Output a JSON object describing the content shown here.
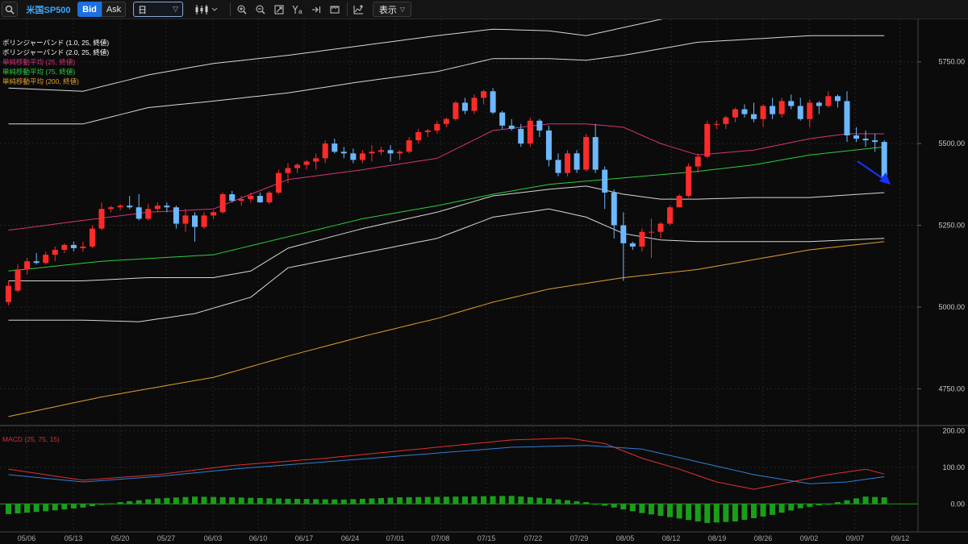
{
  "toolbar": {
    "symbol": "米国SP500",
    "bid_label": "Bid",
    "ask_label": "Ask",
    "period_value": "日",
    "display_label": "表示",
    "icons": [
      "search-icon",
      "candlestick-icon",
      "zoom-in-icon",
      "zoom-out-icon",
      "fit-icon",
      "text-tool-icon",
      "jump-to-end-icon",
      "ruler-icon",
      "indicator-icon"
    ]
  },
  "legend": [
    {
      "text": "ボリンジャーバンド (1.0, 25, 終値)",
      "color": "#ffffff"
    },
    {
      "text": "ボリンジャーバンド (2.0, 25, 終値)",
      "color": "#ffffff"
    },
    {
      "text": "単純移動平均 (25, 終値)",
      "color": "#d6337a"
    },
    {
      "text": "単純移動平均 (75, 終値)",
      "color": "#2ecc40"
    },
    {
      "text": "単純移動平均 (200, 終値)",
      "color": "#e0a030"
    }
  ],
  "macd_legend": "MACD (25, 75, 15)",
  "chart_data": [
    {
      "type": "candlestick",
      "x_labels": [
        "05/06",
        "05/13",
        "05/20",
        "05/27",
        "06/03",
        "06/10",
        "06/17",
        "06/24",
        "07/01",
        "07/08",
        "07/15",
        "07/22",
        "07/29",
        "08/05",
        "08/12",
        "08/19",
        "08/26",
        "09/02",
        "09/07",
        "09/12"
      ],
      "y_ticks": [
        4750,
        5000,
        5250,
        5500,
        5750
      ],
      "y_tick_labels": [
        "4750.00",
        "5000.00",
        "5250.00",
        "5500.00",
        "5750.00"
      ],
      "ylim": [
        4640,
        5880
      ],
      "ohlc": [
        [
          5015,
          5080,
          5005,
          5065
        ],
        [
          5050,
          5130,
          5045,
          5115
        ],
        [
          5115,
          5150,
          5100,
          5140
        ],
        [
          5140,
          5165,
          5130,
          5135
        ],
        [
          5135,
          5170,
          5130,
          5160
        ],
        [
          5160,
          5185,
          5140,
          5175
        ],
        [
          5175,
          5195,
          5165,
          5190
        ],
        [
          5190,
          5200,
          5170,
          5180
        ],
        [
          5180,
          5200,
          5170,
          5185
        ],
        [
          5185,
          5250,
          5180,
          5240
        ],
        [
          5240,
          5320,
          5235,
          5300
        ],
        [
          5300,
          5310,
          5290,
          5305
        ],
        [
          5305,
          5315,
          5295,
          5310
        ],
        [
          5310,
          5340,
          5300,
          5305
        ],
        [
          5305,
          5345,
          5265,
          5270
        ],
        [
          5270,
          5315,
          5265,
          5300
        ],
        [
          5300,
          5320,
          5290,
          5310
        ],
        [
          5310,
          5320,
          5290,
          5305
        ],
        [
          5305,
          5310,
          5240,
          5255
        ],
        [
          5255,
          5300,
          5230,
          5280
        ],
        [
          5280,
          5290,
          5200,
          5245
        ],
        [
          5245,
          5290,
          5240,
          5280
        ],
        [
          5280,
          5295,
          5270,
          5290
        ],
        [
          5290,
          5350,
          5285,
          5345
        ],
        [
          5345,
          5355,
          5320,
          5325
        ],
        [
          5325,
          5340,
          5310,
          5330
        ],
        [
          5330,
          5350,
          5320,
          5340
        ],
        [
          5340,
          5350,
          5320,
          5320
        ],
        [
          5320,
          5355,
          5315,
          5350
        ],
        [
          5350,
          5420,
          5345,
          5410
        ],
        [
          5410,
          5440,
          5380,
          5425
        ],
        [
          5425,
          5440,
          5410,
          5435
        ],
        [
          5435,
          5450,
          5420,
          5445
        ],
        [
          5445,
          5470,
          5420,
          5455
        ],
        [
          5455,
          5510,
          5440,
          5500
        ],
        [
          5500,
          5515,
          5470,
          5475
        ],
        [
          5475,
          5490,
          5455,
          5470
        ],
        [
          5470,
          5485,
          5440,
          5450
        ],
        [
          5450,
          5480,
          5440,
          5470
        ],
        [
          5470,
          5495,
          5445,
          5475
        ],
        [
          5475,
          5490,
          5465,
          5480
        ],
        [
          5480,
          5495,
          5445,
          5470
        ],
        [
          5470,
          5480,
          5450,
          5475
        ],
        [
          5475,
          5520,
          5470,
          5510
        ],
        [
          5510,
          5545,
          5500,
          5535
        ],
        [
          5535,
          5545,
          5520,
          5540
        ],
        [
          5540,
          5570,
          5530,
          5560
        ],
        [
          5560,
          5580,
          5550,
          5575
        ],
        [
          5575,
          5630,
          5570,
          5625
        ],
        [
          5625,
          5640,
          5590,
          5600
        ],
        [
          5600,
          5650,
          5590,
          5640
        ],
        [
          5640,
          5665,
          5620,
          5660
        ],
        [
          5660,
          5670,
          5590,
          5595
        ],
        [
          5595,
          5600,
          5545,
          5555
        ],
        [
          5555,
          5575,
          5540,
          5545
        ],
        [
          5545,
          5560,
          5490,
          5500
        ],
        [
          5500,
          5580,
          5490,
          5570
        ],
        [
          5570,
          5575,
          5520,
          5540
        ],
        [
          5540,
          5555,
          5430,
          5450
        ],
        [
          5450,
          5470,
          5400,
          5410
        ],
        [
          5410,
          5480,
          5400,
          5470
        ],
        [
          5470,
          5480,
          5410,
          5420
        ],
        [
          5420,
          5530,
          5415,
          5520
        ],
        [
          5520,
          5560,
          5410,
          5420
        ],
        [
          5420,
          5430,
          5300,
          5350
        ],
        [
          5350,
          5360,
          5210,
          5250
        ],
        [
          5250,
          5290,
          5080,
          5195
        ],
        [
          5195,
          5200,
          5175,
          5185
        ],
        [
          5185,
          5240,
          5170,
          5230
        ],
        [
          5230,
          5270,
          5150,
          5230
        ],
        [
          5230,
          5260,
          5210,
          5255
        ],
        [
          5255,
          5310,
          5250,
          5305
        ],
        [
          5305,
          5345,
          5305,
          5340
        ],
        [
          5340,
          5440,
          5335,
          5430
        ],
        [
          5430,
          5470,
          5410,
          5460
        ],
        [
          5460,
          5570,
          5455,
          5560
        ],
        [
          5560,
          5570,
          5545,
          5560
        ],
        [
          5560,
          5585,
          5545,
          5580
        ],
        [
          5580,
          5610,
          5565,
          5605
        ],
        [
          5605,
          5620,
          5580,
          5590
        ],
        [
          5590,
          5625,
          5565,
          5575
        ],
        [
          5575,
          5620,
          5550,
          5615
        ],
        [
          5615,
          5640,
          5575,
          5590
        ],
        [
          5590,
          5640,
          5580,
          5630
        ],
        [
          5630,
          5650,
          5605,
          5615
        ],
        [
          5615,
          5640,
          5570,
          5575
        ],
        [
          5575,
          5635,
          5550,
          5625
        ],
        [
          5625,
          5630,
          5590,
          5615
        ],
        [
          5615,
          5660,
          5610,
          5645
        ],
        [
          5645,
          5650,
          5610,
          5630
        ],
        [
          5630,
          5660,
          5505,
          5525
        ],
        [
          5525,
          5550,
          5505,
          5515
        ],
        [
          5515,
          5540,
          5490,
          5510
        ],
        [
          5510,
          5530,
          5475,
          5505
        ],
        [
          5505,
          5510,
          5385,
          5395
        ]
      ],
      "bollinger": {
        "upper_2": [
          5790,
          5800,
          5820,
          5835,
          5850,
          5860,
          5870,
          5875,
          5880
        ],
        "lower_2": [
          4960,
          4970,
          4990,
          5010,
          5040,
          5080,
          5140,
          5180,
          5210
        ]
      }
    },
    {
      "type": "macd",
      "y_ticks": [
        0,
        100,
        200
      ],
      "y_tick_labels": [
        "0.00",
        "100.00",
        "200.00"
      ],
      "ylim": [
        -70,
        210
      ]
    }
  ]
}
